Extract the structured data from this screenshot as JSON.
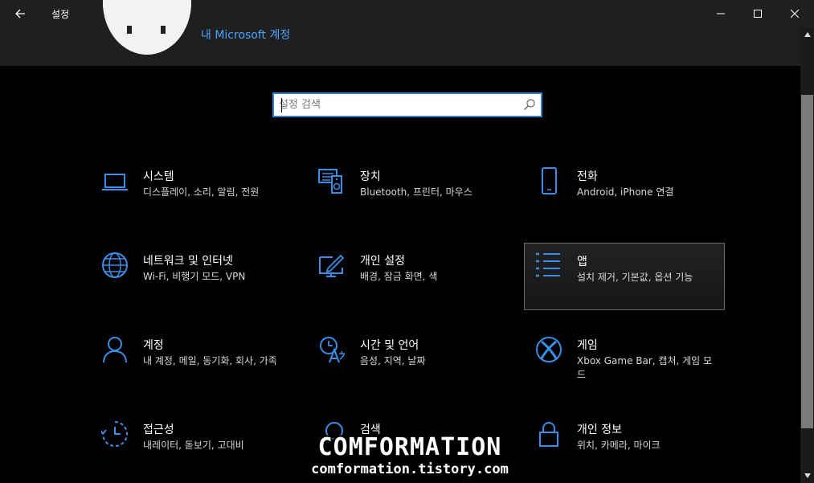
{
  "window": {
    "title": "설정",
    "controls": [
      "minimize",
      "maximize",
      "close"
    ]
  },
  "header": {
    "microsoft_account_link": "내 Microsoft 계정"
  },
  "search": {
    "placeholder": "설정 검색"
  },
  "colors": {
    "accent": "#2f7fd6",
    "icon": "#3a8ee6",
    "link": "#4aa3ff",
    "background": "#000000",
    "titlebar": "#1f1f1f"
  },
  "tiles": [
    {
      "title": "시스템",
      "desc": "디스플레이, 소리, 알림, 전원",
      "icon": "laptop-icon"
    },
    {
      "title": "장치",
      "desc": "Bluetooth, 프린터, 마우스",
      "icon": "devices-icon"
    },
    {
      "title": "전화",
      "desc": "Android, iPhone 연결",
      "icon": "phone-icon"
    },
    {
      "title": "네트워크 및 인터넷",
      "desc": "Wi-Fi, 비행기 모드, VPN",
      "icon": "globe-icon"
    },
    {
      "title": "개인 설정",
      "desc": "배경, 잠금 화면, 색",
      "icon": "personalize-icon"
    },
    {
      "title": "앱",
      "desc": "설치 제거, 기본값, 옵션 기능",
      "icon": "apps-list-icon"
    },
    {
      "title": "계정",
      "desc": "내 계정, 메일, 동기화, 회사, 가족",
      "icon": "person-icon"
    },
    {
      "title": "시간 및 언어",
      "desc": "음성, 지역, 날짜",
      "icon": "time-language-icon"
    },
    {
      "title": "게임",
      "desc": "Xbox Game Bar, 캡처, 게임 모드",
      "icon": "xbox-icon"
    },
    {
      "title": "접근성",
      "desc": "내레이터, 돋보기, 고대비",
      "icon": "accessibility-icon"
    },
    {
      "title": "검색",
      "desc": "",
      "icon": "search-icon"
    },
    {
      "title": "개인 정보",
      "desc": "위치, 카메라, 마이크",
      "icon": "lock-icon"
    }
  ],
  "watermark": {
    "title": "COMFORMATION",
    "url": "comformation.tistory.com"
  }
}
